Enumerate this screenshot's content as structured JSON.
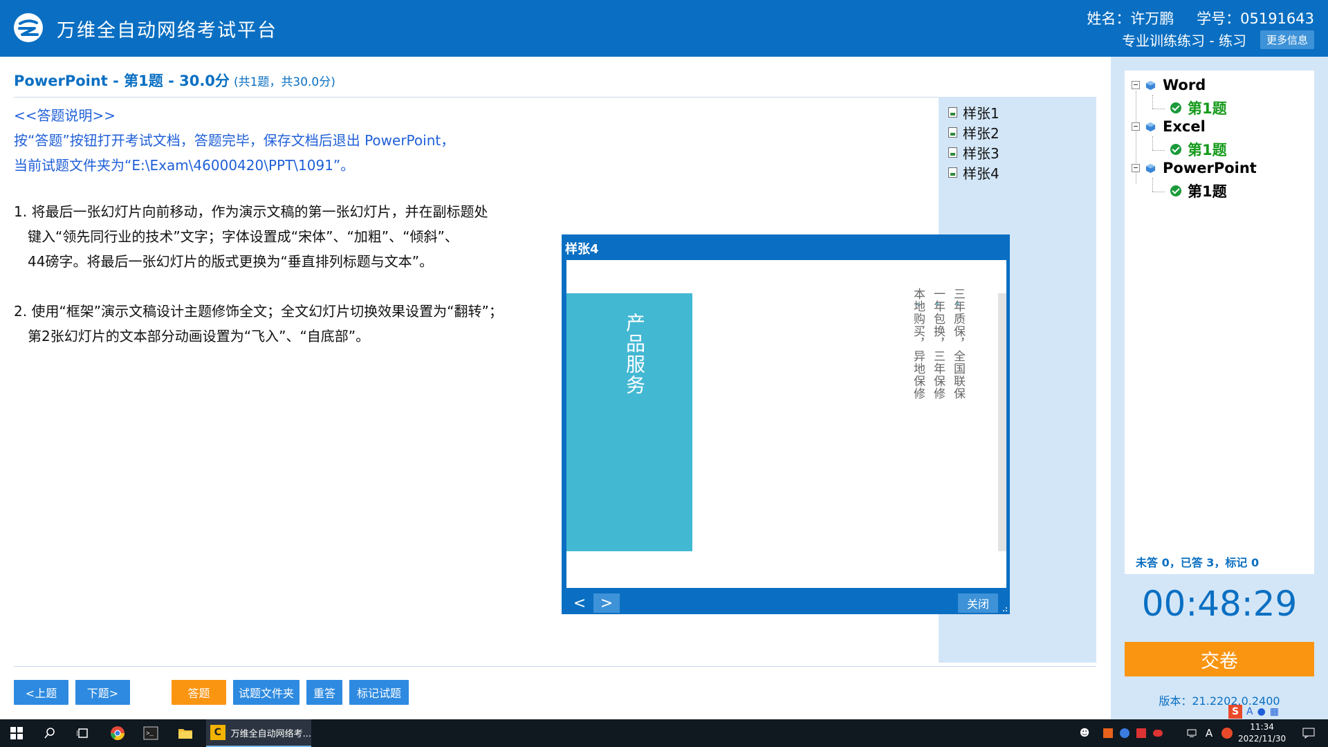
{
  "header": {
    "app_title": "万维全自动网络考试平台",
    "name_label": "姓名：许万鹏",
    "id_label": "学号：05191643",
    "mode": "专业训练练习 - 练习",
    "more_info": "更多信息"
  },
  "question": {
    "title": "PowerPoint - 第1题 - 30.0分",
    "summary": "(共1题，共30.0分)"
  },
  "instructions": {
    "heading": "<<答题说明>>",
    "line1": "按“答题”按钮打开考试文档，答题完毕，保存文档后退出 PowerPoint，",
    "line2": "当前试题文件夹为“E:\\Exam\\46000420\\PPT\\1091”。"
  },
  "tasks": {
    "t1_l1": "1. 将最后一张幻灯片向前移动，作为演示文稿的第一张幻灯片，并在副标题处",
    "t1_l2": "键入“领先同行业的技术”文字；字体设置成“宋体”、“加粗”、“倾斜”、",
    "t1_l3": "44磅字。将最后一张幻灯片的版式更换为“垂直排列标题与文本”。",
    "t2_l1": "2. 使用“框架”演示文稿设计主题修饰全文；全文幻灯片切换效果设置为“翻转”；",
    "t2_l2": "第2张幻灯片的文本部分动画设置为“飞入”、“自底部”。"
  },
  "samples": [
    "样张1",
    "样张2",
    "样张3",
    "样张4"
  ],
  "popup": {
    "title": "样张4",
    "slide_title": "产品服务",
    "slide_col1": "三年质保，全国联保",
    "slide_col2": "一年包换，三年保修",
    "slide_col3": "本地购买，异地保修",
    "prev": "<",
    "next": ">",
    "close": "关闭"
  },
  "buttons": {
    "prev_q": "<上题",
    "next_q": "下题>",
    "answer": "答题",
    "folder": "试题文件夹",
    "redo": "重答",
    "mark": "标记试题"
  },
  "tree": {
    "word": "Word",
    "excel": "Excel",
    "ppt": "PowerPoint",
    "q1": "第1题"
  },
  "status": {
    "stats": "未答 0，已答 3，标记 0",
    "timer": "00:48:29",
    "submit": "交卷",
    "version": "版本：21.2202.0.2400"
  },
  "taskbar": {
    "app_label": "万维全自动网络考...",
    "time": "11:34",
    "date": "2022/11/30",
    "ime_lang": "A"
  },
  "colors": {
    "primary": "#0a6fc2",
    "accent": "#fa9512",
    "slide_block": "#43b8d3",
    "panel": "#d3e6f7"
  }
}
